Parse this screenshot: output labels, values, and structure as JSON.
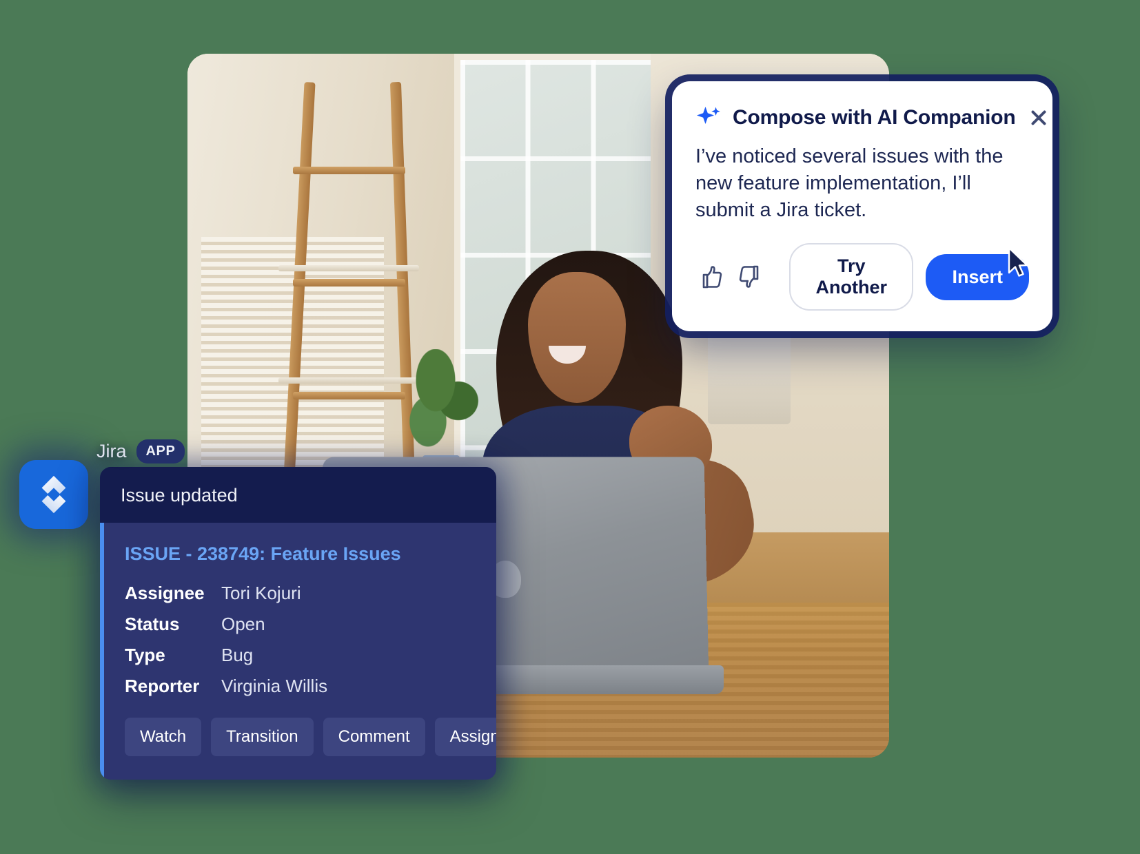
{
  "background": {
    "color": "#4b7a56"
  },
  "photo": {
    "alt": "Woman smiling at laptop in a bright room",
    "interactable": false
  },
  "ai_card": {
    "icon": "sparkle-icon",
    "title": "Compose with AI Companion",
    "close_label": "×",
    "message": "I’ve noticed several issues with the new feature implementation, I’ll submit a Jira ticket.",
    "thumbs_up_icon": "thumbs-up-icon",
    "thumbs_down_icon": "thumbs-down-icon",
    "try_another_label": "Try Another",
    "insert_label": "Insert",
    "accent_color": "#1d5bf5",
    "title_color": "#101a4a",
    "border_glow_color": "#142061"
  },
  "jira_notification": {
    "app_name": "Jira",
    "app_badge": "APP",
    "logo_icon": "jira-logo-icon",
    "logo_color": "#1868db",
    "header_title": "Issue updated",
    "issue_link": "ISSUE - 238749: Feature Issues",
    "issue_link_color": "#6aa5f5",
    "fields": [
      {
        "label": "Assignee",
        "value": "Tori Kojuri"
      },
      {
        "label": "Status",
        "value": "Open"
      },
      {
        "label": "Type",
        "value": "Bug"
      },
      {
        "label": "Reporter",
        "value": "Virginia Willis"
      }
    ],
    "buttons": [
      "Watch",
      "Transition",
      "Comment",
      "Assign"
    ],
    "card_bg": "#2e3570",
    "header_bg": "#141c4e"
  },
  "cursor": {
    "icon": "mouse-pointer-icon"
  }
}
